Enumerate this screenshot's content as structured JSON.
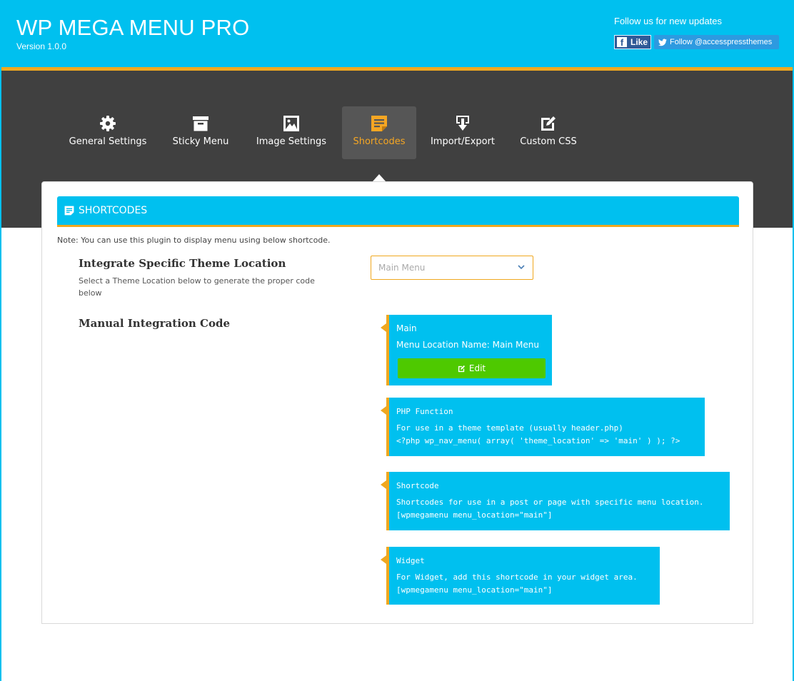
{
  "header": {
    "title": "WP MEGA MENU PRO",
    "version": "Version 1.0.0",
    "follow_text": "Follow us for new updates",
    "fb_like_label": "Like",
    "twitter_follow_label": "Follow @accesspressthemes"
  },
  "tabs": [
    {
      "label": "General Settings",
      "icon": "gear-icon"
    },
    {
      "label": "Sticky Menu",
      "icon": "archive-icon"
    },
    {
      "label": "Image Settings",
      "icon": "image-icon"
    },
    {
      "label": "Shortcodes",
      "icon": "shortcode-icon",
      "active": true
    },
    {
      "label": "Import/Export",
      "icon": "import-export-icon"
    },
    {
      "label": "Custom CSS",
      "icon": "edit-css-icon"
    }
  ],
  "section": {
    "title": "SHORTCODES",
    "note": "Note: You can use this plugin to display menu using below shortcode.",
    "location_heading": "Integrate Specific Theme Location",
    "location_desc": "Select a Theme Location below to generate the proper code below",
    "location_select_value": "Main Menu",
    "manual_heading": "Manual Integration Code"
  },
  "main_box": {
    "name": "Main",
    "location_label": "Menu Location Name: Main Menu",
    "edit_label": "Edit"
  },
  "code_boxes": {
    "php": {
      "title": "PHP Function",
      "desc": "For use in a theme template (usually header.php)",
      "code": "<?php wp_nav_menu( array( 'theme_location' => 'main' ) ); ?>"
    },
    "shortcode": {
      "title": "Shortcode",
      "desc": "Shortcodes for use in a post or page with specific menu location.",
      "code": "[wpmegamenu menu_location=\"main\"]"
    },
    "widget": {
      "title": "Widget",
      "desc": "For Widget, add this shortcode in your widget area.",
      "code": "[wpmegamenu menu_location=\"main\"]"
    }
  },
  "colors": {
    "primary": "#00c0ef",
    "accent": "#f0a81f",
    "nav_bg": "#404040",
    "edit_green": "#4ec900"
  }
}
